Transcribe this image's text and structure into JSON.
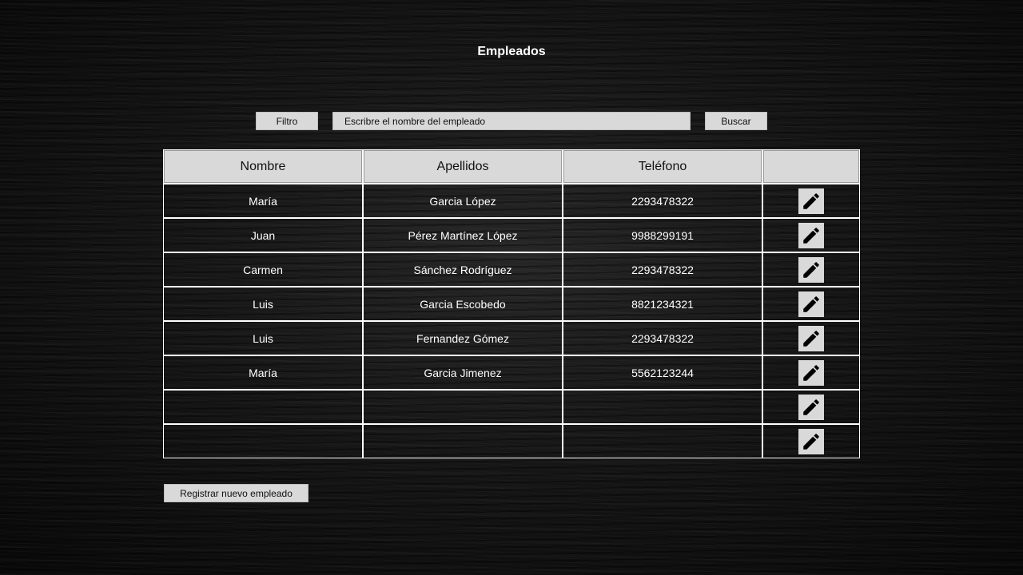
{
  "page": {
    "title": "Empleados"
  },
  "toolbar": {
    "filter_label": "Filtro",
    "search_placeholder": "Escribre el nombre del empleado",
    "search_value": "",
    "search_label": "Buscar"
  },
  "table": {
    "headers": [
      "Nombre",
      "Apellidos",
      "Teléfono",
      ""
    ],
    "rows": [
      {
        "nombre": "María",
        "apellidos": "Garcia López",
        "telefono": "2293478322"
      },
      {
        "nombre": "Juan",
        "apellidos": "Pérez Martínez López",
        "telefono": "9988299191"
      },
      {
        "nombre": "Carmen",
        "apellidos": "Sánchez Rodríguez",
        "telefono": "2293478322"
      },
      {
        "nombre": "Luis",
        "apellidos": "Garcia Escobedo",
        "telefono": "8821234321"
      },
      {
        "nombre": "Luis",
        "apellidos": "Fernandez Gómez",
        "telefono": "2293478322"
      },
      {
        "nombre": "María",
        "apellidos": "Garcia Jimenez",
        "telefono": "5562123244"
      },
      {
        "nombre": "",
        "apellidos": "",
        "telefono": ""
      },
      {
        "nombre": "",
        "apellidos": "",
        "telefono": ""
      }
    ],
    "edit_icon": "pencil-icon"
  },
  "footer": {
    "register_label": "Registrar nuevo empleado"
  },
  "colors": {
    "background": "#0d0d0d",
    "control_fill": "#d9d9d9",
    "text_light": "#ffffff",
    "text_dark": "#111111"
  }
}
